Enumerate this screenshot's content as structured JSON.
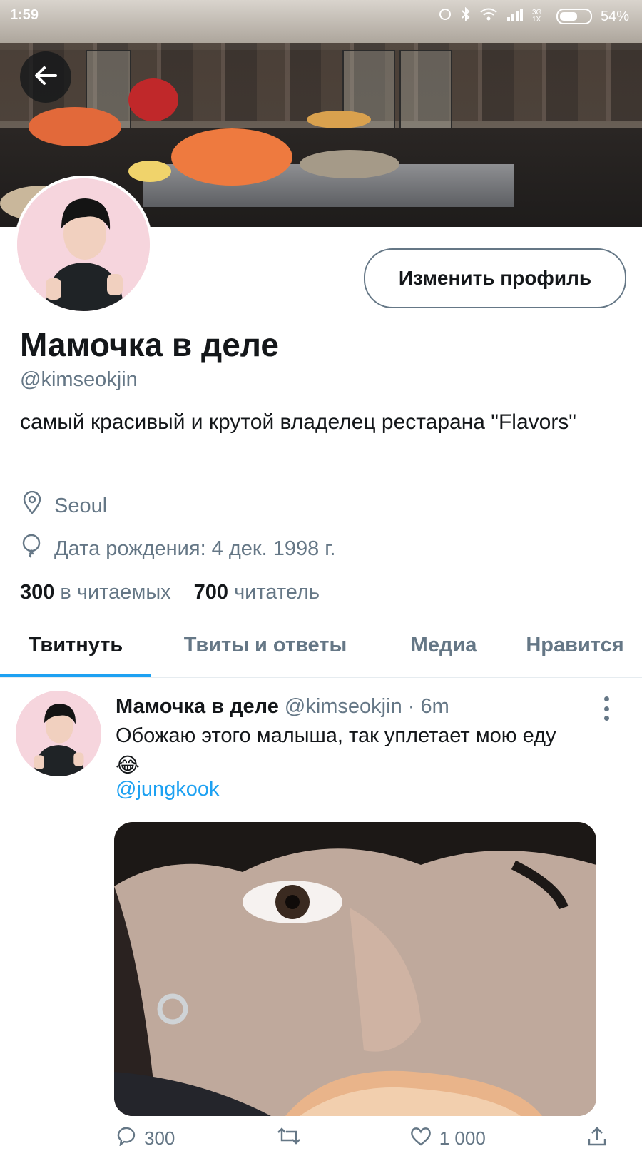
{
  "status_bar": {
    "time": "1:59",
    "network": "3G 1X",
    "battery": "54%"
  },
  "header": {
    "back_icon": "arrow-left-icon"
  },
  "profile": {
    "edit_button_label": "Изменить профиль",
    "display_name": "Мамочка в деле",
    "handle": "@kimseokjin",
    "bio": "самый красивый и крутой владелец рестарана \"Flavors\"",
    "location_icon": "location-pin-icon",
    "location": "Seoul",
    "birthday_icon": "balloon-icon",
    "birthday": "Дата рождения: 4 дек. 1998 г.",
    "following_count": "300",
    "following_label": "в читаемых",
    "followers_count": "700",
    "followers_label": "читатель"
  },
  "tabs": [
    {
      "label": "Твитнуть",
      "active": true
    },
    {
      "label": "Твиты и ответы",
      "active": false
    },
    {
      "label": "Медиа",
      "active": false
    },
    {
      "label": "Нравится",
      "active": false
    }
  ],
  "tweet": {
    "author_name": "Мамочка в деле",
    "author_handle": "@kimseokjin",
    "separator": "·",
    "time": "6m",
    "text": "Обожаю этого малыша, так уплетает мою еду",
    "emoji": "😂",
    "mention": "@jungkook",
    "actions": {
      "reply_count": "300",
      "retweet_count": "",
      "like_count": "1 000",
      "share_icon": "share-icon"
    }
  },
  "colors": {
    "accent": "#1da1f2",
    "secondary_text": "#657786",
    "primary_text": "#14171a"
  }
}
